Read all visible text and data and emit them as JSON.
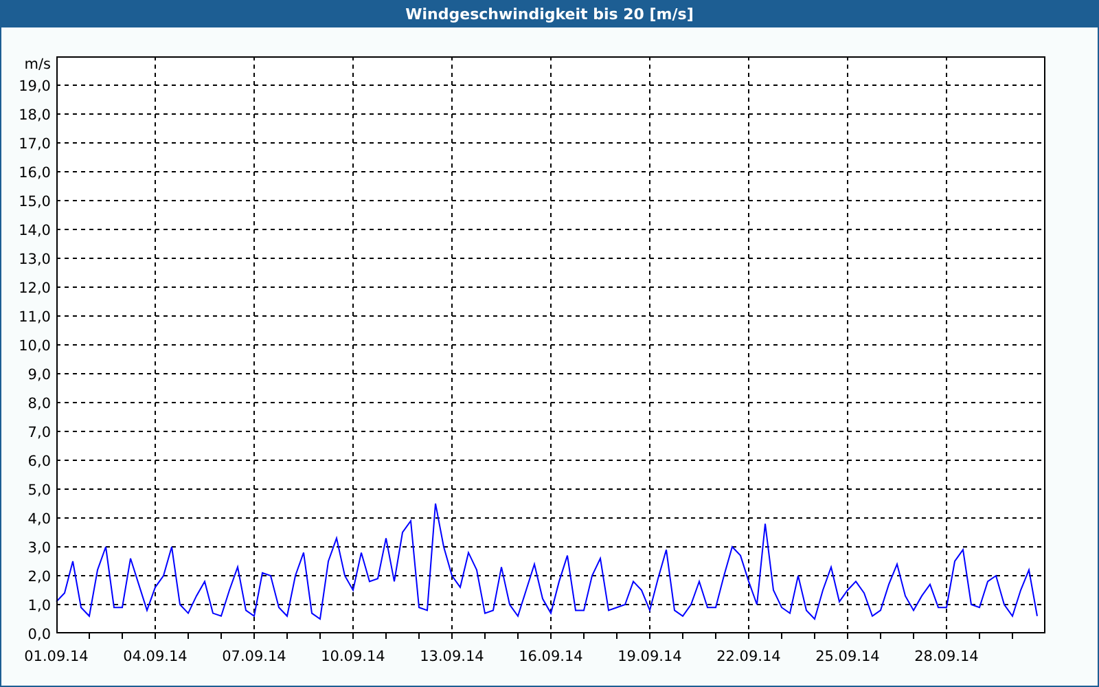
{
  "chart": {
    "chart_data": {
      "type": "line",
      "title": "Windgeschwindigkeit bis 20 [m/s]",
      "ylabel": "m/s",
      "ylim": [
        0,
        20
      ],
      "grid": true,
      "yticks": [
        {
          "value": 0,
          "label": "0,0"
        },
        {
          "value": 1,
          "label": "1,0"
        },
        {
          "value": 2,
          "label": "2,0"
        },
        {
          "value": 3,
          "label": "3,0"
        },
        {
          "value": 4,
          "label": "4,0"
        },
        {
          "value": 5,
          "label": "5,0"
        },
        {
          "value": 6,
          "label": "6,0"
        },
        {
          "value": 7,
          "label": "7,0"
        },
        {
          "value": 8,
          "label": "8,0"
        },
        {
          "value": 9,
          "label": "9,0"
        },
        {
          "value": 10,
          "label": "10,0"
        },
        {
          "value": 11,
          "label": "11,0"
        },
        {
          "value": 12,
          "label": "12,0"
        },
        {
          "value": 13,
          "label": "13,0"
        },
        {
          "value": 14,
          "label": "14,0"
        },
        {
          "value": 15,
          "label": "15,0"
        },
        {
          "value": 16,
          "label": "16,0"
        },
        {
          "value": 17,
          "label": "17,0"
        },
        {
          "value": 18,
          "label": "18,0"
        },
        {
          "value": 19,
          "label": "19,0"
        }
      ],
      "categories": [
        "01.09.14",
        null,
        null,
        null,
        null,
        null,
        null,
        null,
        null,
        null,
        null,
        null,
        "04.09.14",
        null,
        null,
        null,
        null,
        null,
        null,
        null,
        null,
        null,
        null,
        null,
        "07.09.14",
        null,
        null,
        null,
        null,
        null,
        null,
        null,
        null,
        null,
        null,
        null,
        "10.09.14",
        null,
        null,
        null,
        null,
        null,
        null,
        null,
        null,
        null,
        null,
        null,
        "13.09.14",
        null,
        null,
        null,
        null,
        null,
        null,
        null,
        null,
        null,
        null,
        null,
        "16.09.14",
        null,
        null,
        null,
        null,
        null,
        null,
        null,
        null,
        null,
        null,
        null,
        "19.09.14",
        null,
        null,
        null,
        null,
        null,
        null,
        null,
        null,
        null,
        null,
        null,
        "22.09.14",
        null,
        null,
        null,
        null,
        null,
        null,
        null,
        null,
        null,
        null,
        null,
        "25.09.14",
        null,
        null,
        null,
        null,
        null,
        null,
        null,
        null,
        null,
        null,
        null,
        "28.09.14",
        null,
        null,
        null,
        null,
        null,
        null,
        null,
        null,
        null,
        null,
        null
      ],
      "series": [
        {
          "color": "#0000ff",
          "values": [
            1.1,
            1.4,
            2.5,
            0.9,
            0.6,
            2.2,
            3.0,
            0.9,
            0.9,
            2.6,
            1.7,
            0.8,
            1.6,
            2.0,
            3.0,
            1.0,
            0.7,
            1.3,
            1.8,
            0.7,
            0.6,
            1.5,
            2.3,
            0.8,
            0.6,
            2.1,
            2.0,
            0.9,
            0.6,
            2.0,
            2.8,
            0.7,
            0.5,
            2.5,
            3.3,
            2.0,
            1.5,
            2.8,
            1.8,
            1.9,
            3.3,
            1.8,
            3.5,
            3.9,
            0.9,
            0.8,
            4.5,
            3.0,
            2.0,
            1.6,
            2.8,
            2.2,
            0.7,
            0.8,
            2.3,
            1.0,
            0.6,
            1.5,
            2.4,
            1.2,
            0.7,
            1.8,
            2.7,
            0.8,
            0.8,
            2.0,
            2.6,
            0.8,
            0.9,
            1.0,
            1.8,
            1.5,
            0.8,
            1.9,
            2.9,
            0.8,
            0.6,
            1.0,
            1.8,
            0.9,
            0.9,
            2.0,
            3.0,
            2.7,
            1.8,
            1.0,
            3.8,
            1.5,
            0.9,
            0.7,
            2.0,
            0.8,
            0.5,
            1.5,
            2.3,
            1.1,
            1.5,
            1.8,
            1.4,
            0.6,
            0.8,
            1.7,
            2.4,
            1.3,
            0.8,
            1.3,
            1.7,
            0.9,
            0.9,
            2.5,
            2.9,
            1.0,
            0.9,
            1.8,
            2.0,
            1.0,
            0.6,
            1.5,
            2.2,
            0.6
          ]
        }
      ]
    }
  }
}
